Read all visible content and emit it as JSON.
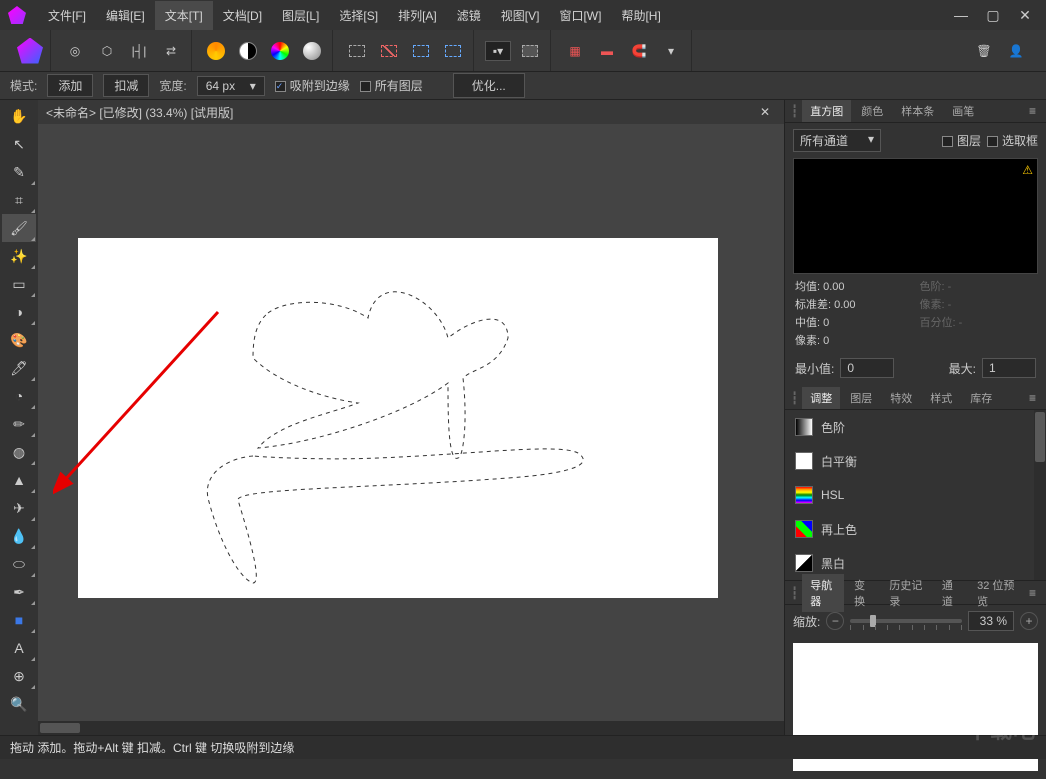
{
  "menu": [
    "文件[F]",
    "编辑[E]",
    "文本[T]",
    "文档[D]",
    "图层[L]",
    "选择[S]",
    "排列[A]",
    "滤镜",
    "视图[V]",
    "窗口[W]",
    "帮助[H]"
  ],
  "menu_active_index": 2,
  "window_controls": {
    "min": "—",
    "max": "▢",
    "close": "✕"
  },
  "context": {
    "mode_label": "模式:",
    "add": "添加",
    "subtract": "扣减",
    "width_label": "宽度:",
    "width_value": "64 px",
    "snap_edges": "吸附到边缘",
    "all_layers": "所有图层",
    "optimize": "优化..."
  },
  "doc_tab": "<未命名> [已修改] (33.4%) [试用版]",
  "left_tools": [
    {
      "name": "hand-tool",
      "glyph": "✋",
      "tri": false
    },
    {
      "name": "move-tool",
      "glyph": "↖",
      "tri": false
    },
    {
      "name": "color-picker-tool",
      "glyph": "✎",
      "tri": true
    },
    {
      "name": "crop-tool",
      "glyph": "⌗",
      "tri": true
    },
    {
      "name": "selection-brush-tool",
      "glyph": "🖌",
      "tri": true,
      "active": true
    },
    {
      "name": "magic-wand-tool",
      "glyph": "✨",
      "tri": true
    },
    {
      "name": "marquee-tool",
      "glyph": "▭",
      "tri": true
    },
    {
      "name": "flood-select-tool",
      "glyph": "◑",
      "tri": true
    },
    {
      "name": "paint-mixer-tool",
      "glyph": "🎨",
      "tri": false
    },
    {
      "name": "brush-tool",
      "glyph": "🖊",
      "tri": true
    },
    {
      "name": "pixel-tool",
      "glyph": "◔",
      "tri": true
    },
    {
      "name": "pencil-tool",
      "glyph": "✏",
      "tri": true
    },
    {
      "name": "fill-tool",
      "glyph": "◍",
      "tri": true
    },
    {
      "name": "gradient-tool",
      "glyph": "▲",
      "tri": true
    },
    {
      "name": "healing-brush-tool",
      "glyph": "✈",
      "tri": true
    },
    {
      "name": "blur-tool",
      "glyph": "💧",
      "tri": true
    },
    {
      "name": "clone-tool",
      "glyph": "⬭",
      "tri": true
    },
    {
      "name": "pen-tool",
      "glyph": "✒",
      "tri": true
    },
    {
      "name": "shape-tool",
      "glyph": "■",
      "tri": true,
      "color": "#3b78e7"
    },
    {
      "name": "text-tool",
      "glyph": "A",
      "tri": true
    },
    {
      "name": "mesh-tool",
      "glyph": "⊕",
      "tri": true
    },
    {
      "name": "zoom-tool",
      "glyph": "🔍",
      "tri": false
    }
  ],
  "right": {
    "hist_tabs": [
      "直方图",
      "颜色",
      "样本条",
      "画笔"
    ],
    "hist_active": 0,
    "channel_label": "所有通道",
    "layer_chk": "图层",
    "selection_chk": "选取框",
    "stats": {
      "mean_l": "均值:",
      "mean_v": "0.00",
      "std_l": "标准差:",
      "std_v": "0.00",
      "median_l": "中值:",
      "median_v": "0",
      "pixels_l": "像素:",
      "pixels_v": "0",
      "peak_l": "色阶:",
      "peak_v": "-",
      "count_l": "像素:",
      "count_v": "-",
      "pct_l": "百分位:",
      "pct_v": "-"
    },
    "min_l": "最小值:",
    "min_v": "0",
    "max_l": "最大:",
    "max_v": "1",
    "adj_tabs": [
      "调整",
      "图层",
      "特效",
      "样式",
      "库存"
    ],
    "adj_active": 0,
    "adjustments": [
      {
        "name": "levels",
        "label": "色阶",
        "sw": "linear-gradient(90deg,#000,#fff)"
      },
      {
        "name": "white-balance",
        "label": "白平衡",
        "sw": "#fff"
      },
      {
        "name": "hsl",
        "label": "HSL",
        "sw": "linear-gradient(180deg,red,orange,yellow,green,cyan,blue,magenta)"
      },
      {
        "name": "recolor",
        "label": "再上色",
        "sw": "linear-gradient(45deg,red 0 33%,lime 33% 66%,blue 66%)"
      },
      {
        "name": "black-white",
        "label": "黑白",
        "sw": "linear-gradient(135deg,#fff 50%,#000 50%)"
      }
    ],
    "nav_tabs": [
      "导航器",
      "变换",
      "历史记录",
      "通道",
      "32 位预览"
    ],
    "nav_active": 0,
    "zoom_label": "缩放:",
    "zoom_value": "33 %"
  },
  "status_bar": "拖动 添加。拖动+Alt 键 扣减。Ctrl 键 切换吸附到边缘",
  "watermark": "下载吧"
}
